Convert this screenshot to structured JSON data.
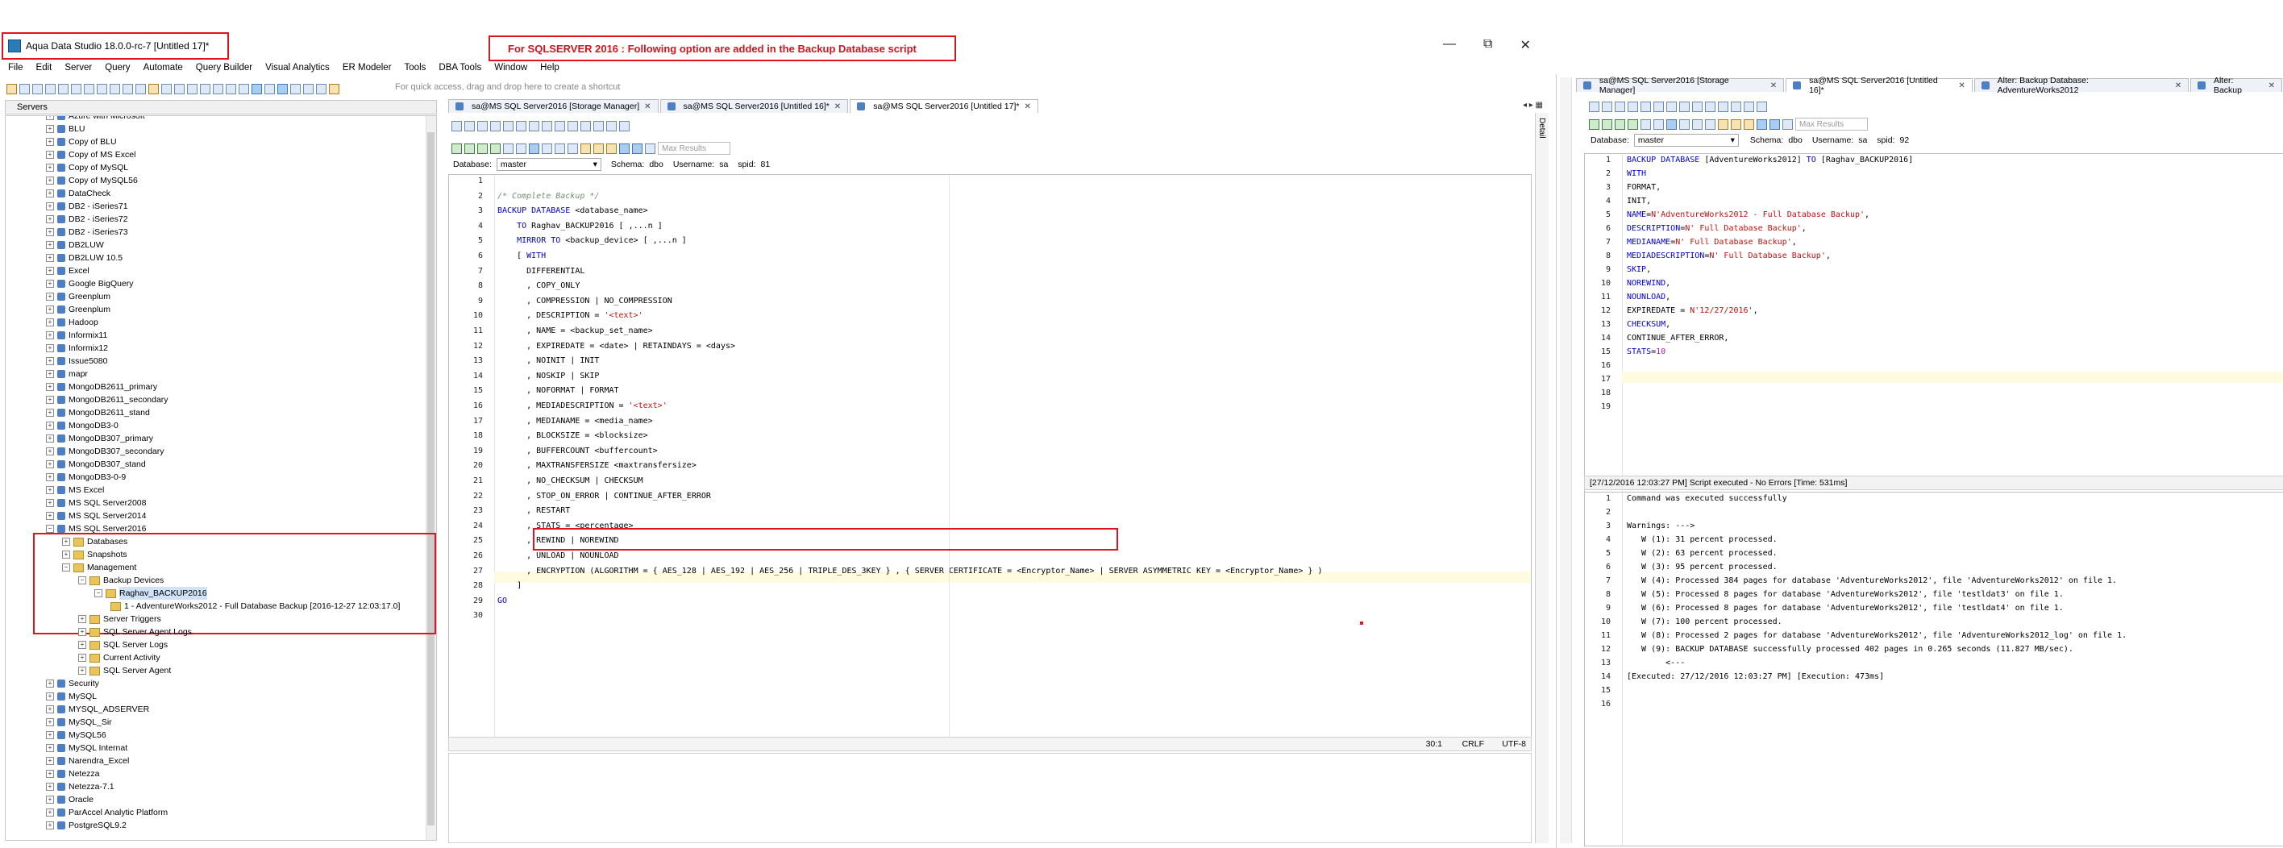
{
  "window": {
    "title": "Aqua Data Studio 18.0.0-rc-7 [Untitled 17]*",
    "annotation": "For SQLSERVER 2016 : Following option are added in the Backup Database script",
    "minimize": "—",
    "restore": "⧉",
    "close": "✕"
  },
  "menu": [
    "File",
    "Edit",
    "Server",
    "Query",
    "Automate",
    "Query Builder",
    "Visual Analytics",
    "ER Modeler",
    "Tools",
    "DBA Tools",
    "Window",
    "Help"
  ],
  "quick_access": "For quick access, drag and drop here to create a shortcut",
  "servers_panel": {
    "title": "Servers",
    "items": [
      {
        "label": "Azure with Microsoft"
      },
      {
        "label": "BLU"
      },
      {
        "label": "Copy of BLU"
      },
      {
        "label": "Copy of MS Excel"
      },
      {
        "label": "Copy of MySQL"
      },
      {
        "label": "Copy of MySQL56"
      },
      {
        "label": "DataCheck"
      },
      {
        "label": "DB2 - iSeries71"
      },
      {
        "label": "DB2 - iSeries72"
      },
      {
        "label": "DB2 - iSeries73"
      },
      {
        "label": "DB2LUW"
      },
      {
        "label": "DB2LUW 10.5"
      },
      {
        "label": "Excel"
      },
      {
        "label": "Google BigQuery"
      },
      {
        "label": "Greenplum"
      },
      {
        "label": "Greenplum"
      },
      {
        "label": "Hadoop"
      },
      {
        "label": "Informix11"
      },
      {
        "label": "Informix12"
      },
      {
        "label": "Issue5080"
      },
      {
        "label": "mapr"
      },
      {
        "label": "MongoDB2611_primary"
      },
      {
        "label": "MongoDB2611_secondary"
      },
      {
        "label": "MongoDB2611_stand"
      },
      {
        "label": "MongoDB3-0"
      },
      {
        "label": "MongoDB307_primary"
      },
      {
        "label": "MongoDB307_secondary"
      },
      {
        "label": "MongoDB307_stand"
      },
      {
        "label": "MongoDB3-0-9"
      },
      {
        "label": "MS Excel"
      },
      {
        "label": "MS SQL Server2008"
      },
      {
        "label": "MS SQL Server2014"
      },
      {
        "label": "MS SQL Server2016"
      },
      {
        "label": "Databases"
      },
      {
        "label": "Snapshots"
      },
      {
        "label": "Management"
      },
      {
        "label": "Backup Devices"
      },
      {
        "label": "Raghav_BACKUP2016"
      },
      {
        "label": "1 - AdventureWorks2012 - Full Database Backup [2016-12-27 12:03:17.0]"
      },
      {
        "label": "Server Triggers"
      },
      {
        "label": "SQL Server Agent Logs"
      },
      {
        "label": "SQL Server Logs"
      },
      {
        "label": "Current Activity"
      },
      {
        "label": "SQL Server Agent"
      },
      {
        "label": "Security"
      },
      {
        "label": "MySQL"
      },
      {
        "label": "MYSQL_ADSERVER"
      },
      {
        "label": "MySQL_Sir"
      },
      {
        "label": "MySQL56"
      },
      {
        "label": "MySQL Internat"
      },
      {
        "label": "Narendra_Excel"
      },
      {
        "label": "Netezza"
      },
      {
        "label": "Netezza-7.1"
      },
      {
        "label": "Oracle"
      },
      {
        "label": "ParAccel Analytic Platform"
      },
      {
        "label": "PostgreSQL9.2"
      }
    ]
  },
  "editor_left": {
    "tabs": [
      {
        "label": "sa@MS SQL Server2016 [Storage Manager]"
      },
      {
        "label": "sa@MS SQL Server2016 [Untitled 16]*"
      },
      {
        "label": "sa@MS SQL Server2016 [Untitled 17]*"
      }
    ],
    "max_results": "Max Results",
    "database_label": "Database:",
    "database_value": "master",
    "schema_label": "Schema:",
    "schema_value": "dbo",
    "username_label": "Username:",
    "username_value": "sa",
    "spid_label": "spid:",
    "spid_value": "81",
    "side_tab": "Detail",
    "lines": [
      "",
      "/* Complete Backup */",
      "BACKUP DATABASE <database_name>",
      "    TO Raghav_BACKUP2016 [ ,...n ]",
      "    MIRROR TO <backup_device> [ ,...n ]",
      "    [ WITH",
      "      DIFFERENTIAL",
      "      , COPY_ONLY",
      "      , COMPRESSION | NO_COMPRESSION",
      "      , DESCRIPTION = '<text>'",
      "      , NAME = <backup_set_name>",
      "      , EXPIREDATE = <date> | RETAINDAYS = <days>",
      "      , NOINIT | INIT",
      "      , NOSKIP | SKIP",
      "      , NOFORMAT | FORMAT",
      "      , MEDIADESCRIPTION = '<text>'",
      "      , MEDIANAME = <media_name>",
      "      , BLOCKSIZE = <blocksize>",
      "      , BUFFERCOUNT <buffercount>",
      "      , MAXTRANSFERSIZE <maxtransfersize>",
      "      , NO_CHECKSUM | CHECKSUM",
      "      , STOP_ON_ERROR | CONTINUE_AFTER_ERROR",
      "      , RESTART",
      "      , STATS = <percentage>",
      "      , REWIND | NOREWIND",
      "      , UNLOAD | NOUNLOAD",
      "      , ENCRYPTION (ALGORITHM = { AES_128 | AES_192 | AES_256 | TRIPLE_DES_3KEY } , { SERVER CERTIFICATE = <Encryptor_Name> | SERVER ASYMMETRIC KEY = <Encryptor_Name> } )",
      "    ]",
      "GO",
      ""
    ],
    "status": {
      "position": "30:1",
      "line_ending": "CRLF",
      "encoding": "UTF-8"
    }
  },
  "editor_right": {
    "tabs": [
      {
        "label": "sa@MS SQL Server2016 [Storage Manager]"
      },
      {
        "label": "sa@MS SQL Server2016 [Untitled 16]*"
      },
      {
        "label": "Alter: Backup Database: AdventureWorks2012"
      },
      {
        "label": "Alter: Backup"
      }
    ],
    "max_results": "Max Results",
    "database_label": "Database:",
    "database_value": "master",
    "schema_label": "Schema:",
    "schema_value": "dbo",
    "username_label": "Username:",
    "username_value": "sa",
    "spid_label": "spid:",
    "spid_value": "92",
    "lines": [
      "BACKUP DATABASE [AdventureWorks2012] TO [Raghav_BACKUP2016]",
      "WITH",
      "FORMAT,",
      "INIT,",
      "NAME=N'AdventureWorks2012 - Full Database Backup',",
      "DESCRIPTION=N' Full Database Backup',",
      "MEDIANAME=N' Full Database Backup',",
      "MEDIADESCRIPTION=N' Full Database Backup',",
      "SKIP,",
      "NOREWIND,",
      "NOUNLOAD,",
      "EXPIREDATE = N'12/27/2016',",
      "CHECKSUM,",
      "CONTINUE_AFTER_ERROR,",
      "STATS=10",
      "",
      "",
      "",
      ""
    ],
    "result_header": "[27/12/2016 12:03:27 PM] Script executed - No Errors [Time: 531ms]",
    "results": [
      "Command was executed successfully",
      "",
      "Warnings: --->",
      "   W (1): 31 percent processed.",
      "   W (2): 63 percent processed.",
      "   W (3): 95 percent processed.",
      "   W (4): Processed 384 pages for database 'AdventureWorks2012', file 'AdventureWorks2012' on file 1.",
      "   W (5): Processed 8 pages for database 'AdventureWorks2012', file 'testldat3' on file 1.",
      "   W (6): Processed 8 pages for database 'AdventureWorks2012', file 'testldat4' on file 1.",
      "   W (7): 100 percent processed.",
      "   W (8): Processed 2 pages for database 'AdventureWorks2012', file 'AdventureWorks2012_log' on file 1.",
      "   W (9): BACKUP DATABASE successfully processed 402 pages in 0.265 seconds (11.827 MB/sec).",
      "        <---",
      "[Executed: 27/12/2016 12:03:27 PM] [Execution: 473ms]",
      "",
      ""
    ]
  }
}
